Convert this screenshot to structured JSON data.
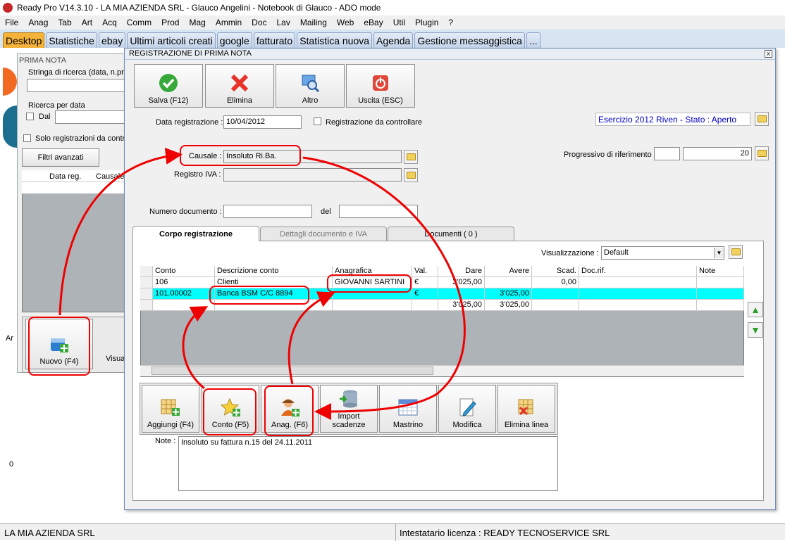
{
  "window": {
    "title": "Ready Pro V14.3.10 - LA MIA AZIENDA SRL - Glauco Angelini - Notebook di Glauco - ADO mode"
  },
  "menu": [
    "File",
    "Anag",
    "Tab",
    "Art",
    "Acq",
    "Comm",
    "Prod",
    "Mag",
    "Ammin",
    "Doc",
    "Lav",
    "Mailing",
    "Web",
    "eBay",
    "Util",
    "Plugin",
    "?"
  ],
  "tabs": [
    "Desktop",
    "Statistiche",
    "ebay",
    "Ultimi articoli creati",
    "google",
    "fatturato",
    "Statistica nuova",
    "Agenda",
    "Gestione messaggistica",
    "..."
  ],
  "left_panel": {
    "title": "PRIMA NOTA",
    "search_label": "Stringa di ricerca (data, n.pro",
    "date_search_label": "Ricerca per data",
    "dal_label": "Dal",
    "only_reg_label": "Solo registrazioni da contro",
    "filters_button": "Filtri avanzati",
    "grid_headers": [
      "Data reg.",
      "Causale"
    ],
    "new_button": "Nuovo (F4)",
    "view_button": "Visua",
    "side_letter_a": "Ar",
    "side_letter_o": "0"
  },
  "dialog": {
    "title": "REGISTRAZIONE DI PRIMA NOTA",
    "close": "x",
    "toolbar": [
      "Salva (F12)",
      "Elimina",
      "Altro",
      "Uscita (ESC)"
    ],
    "date_label": "Data registrazione :",
    "date_value": "10/04/2012",
    "to_check_label": "Registrazione da controllare",
    "esercizio": "Esercizio 2012 Riven - Stato : Aperto",
    "causale_label": "Causale :",
    "causale_value": "Insoluto Ri.Ba.",
    "registro_label": "Registro IVA :",
    "progressivo_label": "Progressivo di riferimento :",
    "progressivo_value": "20",
    "numero_label": "Numero documento :",
    "del_label": "del",
    "subtabs": [
      "Corpo registrazione",
      "Dettagli documento e IVA",
      "Documenti ( 0 )"
    ],
    "visualizzazione_label": "Visualizzazione :",
    "visualizzazione_value": "Default",
    "grid": {
      "headers": [
        "Conto",
        "Descrizione conto",
        "Anagrafica",
        "Val.",
        "Dare",
        "Avere",
        "Scad.",
        "Doc.rif.",
        "Note"
      ],
      "rows": [
        [
          "106",
          "Clienti",
          "GIOVANNI SARTINI",
          "€",
          "3'025,00",
          "",
          "0,00",
          "",
          ""
        ],
        [
          "101.00002",
          "Banca BSM C/C 8894",
          "",
          "€",
          "",
          "3'025,00",
          "",
          "",
          ""
        ],
        [
          "",
          "",
          "",
          "",
          "3'025,00",
          "3'025,00",
          "",
          "",
          ""
        ]
      ]
    },
    "bottom_buttons": [
      "Aggiungi (F4)",
      "Conto (F5)",
      "Anag. (F6)",
      "Import scadenze",
      "Mastrino",
      "Modifica",
      "Elimina linea"
    ],
    "note_label": "Note :",
    "note_value": "Insoluto su fattura n.15 del 24.11.2011"
  },
  "status": {
    "left": "LA MIA AZIENDA SRL",
    "right": "Intestatario licenza : READY TECNOSERVICE SRL"
  },
  "colors": {
    "active_tab": "#f5b33a",
    "selected_row": "#00ffff",
    "annotation": "#e00000",
    "esercizio_text": "#0000c0"
  }
}
